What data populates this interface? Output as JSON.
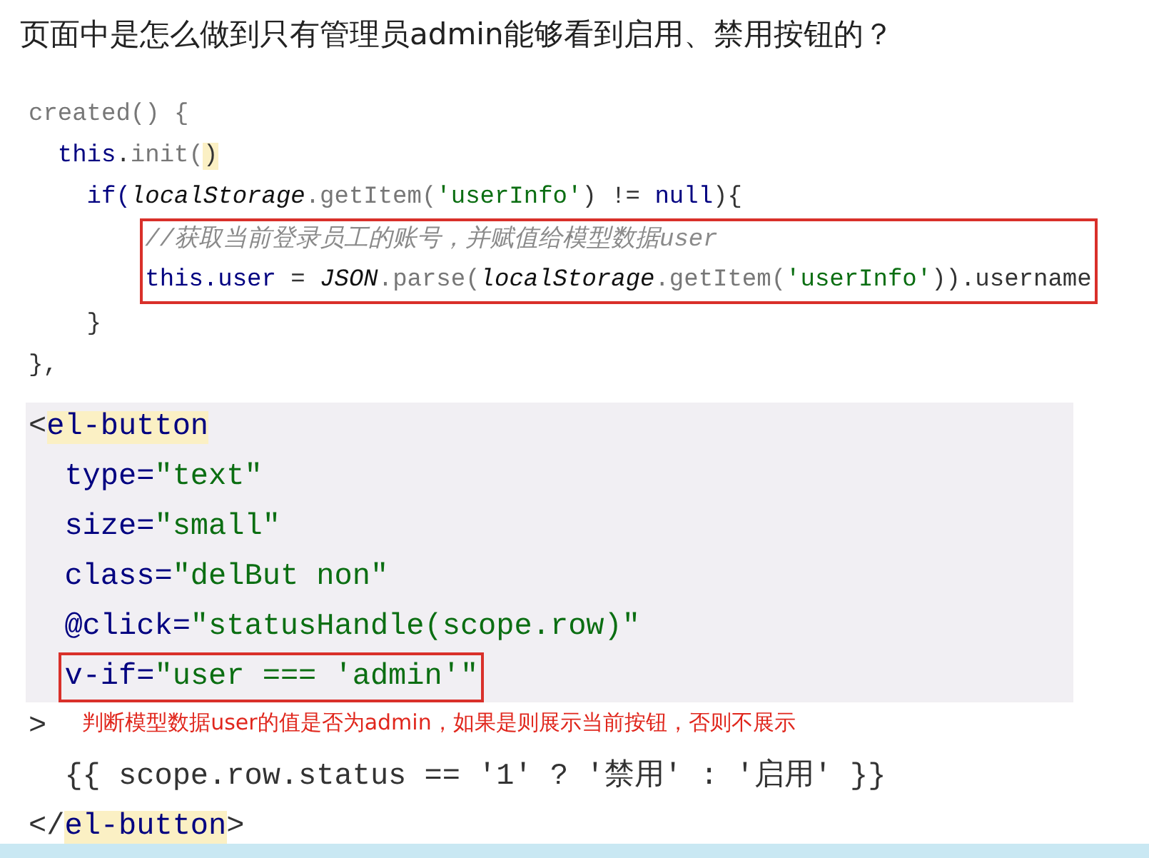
{
  "question": "页面中是怎么做到只有管理员admin能够看到启用、禁用按钮的？",
  "code_blocks": [
    {
      "groups": [
        {
          "kind": "plain",
          "lines": [
            {
              "tokens": [
                {
                  "text": "created() {",
                  "kind": "fn"
                }
              ]
            },
            {
              "tokens": [
                {
                  "text": "  this",
                  "kind": "kw"
                },
                {
                  "text": ".",
                  "kind": "plain"
                },
                {
                  "text": "init(",
                  "kind": "fn"
                },
                {
                  "text": ")",
                  "kind": "match"
                }
              ]
            },
            {
              "tokens": [
                {
                  "text": "    if(",
                  "kind": "kw"
                },
                {
                  "text": "localStorage",
                  "kind": "ital"
                },
                {
                  "text": ".getItem(",
                  "kind": "fn"
                },
                {
                  "text": "'userInfo'",
                  "kind": "str"
                },
                {
                  "text": ") != ",
                  "kind": "plain"
                },
                {
                  "text": "null",
                  "kind": "kw"
                },
                {
                  "text": "){",
                  "kind": "plain"
                }
              ]
            },
            {
              "kind": "boxed",
              "lines": [
                {
                  "tokens": [
                    {
                      "text": "        //获取当前登录员工的账号，并赋值给模型数据user",
                      "kind": "comment"
                    }
                  ]
                },
                {
                  "tokens": [
                    {
                      "text": "        this.user",
                      "kind": "kw"
                    },
                    {
                      "text": " = ",
                      "kind": "plain"
                    },
                    {
                      "text": "JSON",
                      "kind": "ital"
                    },
                    {
                      "text": ".parse(",
                      "kind": "fn"
                    },
                    {
                      "text": "localStorage",
                      "kind": "ital"
                    },
                    {
                      "text": ".getItem(",
                      "kind": "fn"
                    },
                    {
                      "text": "'userInfo'",
                      "kind": "str"
                    },
                    {
                      "text": ")).username",
                      "kind": "plain"
                    }
                  ]
                }
              ]
            },
            {
              "tokens": [
                {
                  "text": "    }",
                  "kind": "plain"
                }
              ]
            },
            {
              "tokens": [
                {
                  "text": "},",
                  "kind": "plain"
                }
              ]
            }
          ]
        }
      ]
    },
    {
      "groups": [
        {
          "kind": "shaded",
          "lines": [
            {
              "tokens": [
                {
                  "text": "<",
                  "kind": "plain"
                },
                {
                  "text": "el-button",
                  "kind": "tag"
                }
              ]
            },
            {
              "tokens": [
                {
                  "text": "  type=",
                  "kind": "kw"
                },
                {
                  "text": "\"text\"",
                  "kind": "str"
                }
              ]
            },
            {
              "tokens": [
                {
                  "text": "  size=",
                  "kind": "kw"
                },
                {
                  "text": "\"small\"",
                  "kind": "str"
                }
              ]
            },
            {
              "tokens": [
                {
                  "text": "  class=",
                  "kind": "kw"
                },
                {
                  "text": "\"delBut non\"",
                  "kind": "str"
                }
              ]
            },
            {
              "tokens": [
                {
                  "text": "  @click=",
                  "kind": "kw"
                },
                {
                  "text": "\"statusHandle(scope.row)\"",
                  "kind": "str"
                }
              ]
            },
            {
              "kind": "boxed",
              "lines": [
                {
                  "tokens": [
                    {
                      "text": "  v-if=",
                      "kind": "kw"
                    },
                    {
                      "text": "\"user === 'admin'\"",
                      "kind": "str"
                    }
                  ]
                }
              ]
            }
          ]
        },
        {
          "kind": "plain",
          "lines": [
            {
              "tokens": [
                {
                  "text": ">",
                  "kind": "plain"
                }
              ],
              "note": "判断模型数据user的值是否为admin，如果是则展示当前按钮，否则不展示"
            },
            {
              "tokens": [
                {
                  "text": "  {{ scope.row.status == '1' ? '禁用' : '启用' }}",
                  "kind": "plain"
                }
              ]
            },
            {
              "tokens": [
                {
                  "text": "</",
                  "kind": "plain"
                },
                {
                  "text": "el-button",
                  "kind": "tag"
                },
                {
                  "text": ">",
                  "kind": "plain"
                }
              ]
            }
          ]
        }
      ]
    }
  ]
}
